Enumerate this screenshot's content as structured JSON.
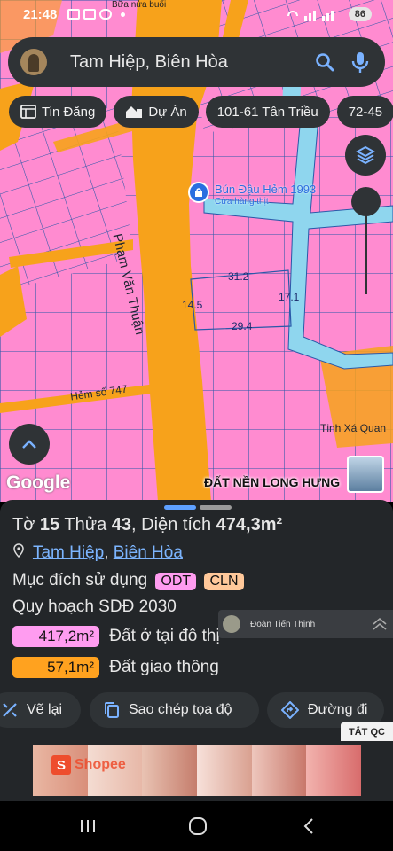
{
  "status_bar": {
    "time": "21:48",
    "battery": "86"
  },
  "search": {
    "query": "Tam Hiệp, Biên Hòa"
  },
  "chips": [
    {
      "label": "Tin Đăng",
      "icon": "news-icon"
    },
    {
      "label": "Dự Án",
      "icon": "project-building-icon"
    },
    {
      "label": "101-61 Tân Triều",
      "icon": ""
    },
    {
      "label": "72-45",
      "icon": ""
    }
  ],
  "map": {
    "road_name": "Phạm Văn Thuận",
    "poi_name": "Bún Đậu Hẻm 1993",
    "poi_subtitle": "Cửa hàng thịt",
    "alley_label": "Hẻm số 747",
    "place_label": "Tịnh Xá Quan",
    "dimensions": [
      "31.2",
      "17.1",
      "14.5",
      "29.4"
    ],
    "attribution": "Google",
    "ad_label": "ĐẤT NỀN LONG HƯNG",
    "top_partial_label": "Bữa nửa buổi"
  },
  "parcel": {
    "sheet_prefix": "Tờ",
    "sheet_no": "15",
    "lot_prefix": "Thửa",
    "lot_no": "43",
    "area_prefix": "Diện tích",
    "area": "474,3m²",
    "ward": "Tam Hiệp",
    "city": "Biên Hòa",
    "separator": ",",
    "purpose_label": "Mục đích sử dụng",
    "purpose_tags": [
      "ODT",
      "CLN"
    ],
    "plan_label": "Quy hoạch SDĐ 2030",
    "plan_items": [
      {
        "area": "417,2m²",
        "label": "Đất ở tại đô thị",
        "color": "#ff9cf0"
      },
      {
        "area": "57,1m²",
        "label": "Đất giao thông",
        "color": "#ffa21f"
      }
    ]
  },
  "notification": {
    "name": "Đoàn Tiến Thịnh"
  },
  "actions": [
    {
      "label": "Vẽ lại",
      "icon": "redraw-icon"
    },
    {
      "label": "Sao chép tọa độ",
      "icon": "copy-icon"
    },
    {
      "label": "Đường đi",
      "icon": "directions-icon"
    }
  ],
  "ad_banner": {
    "close_label": "TẮT QC",
    "brand": "Shopee"
  },
  "colors": {
    "residential": "#ff8bd0",
    "road": "#f7a21b",
    "canal": "#8fd6ee",
    "sheet_bg": "#232629",
    "chip_bg": "#2f3336",
    "link": "#7cb5ff",
    "tag_odt": "#ff9cf0",
    "tag_cln": "#ffc89a"
  }
}
